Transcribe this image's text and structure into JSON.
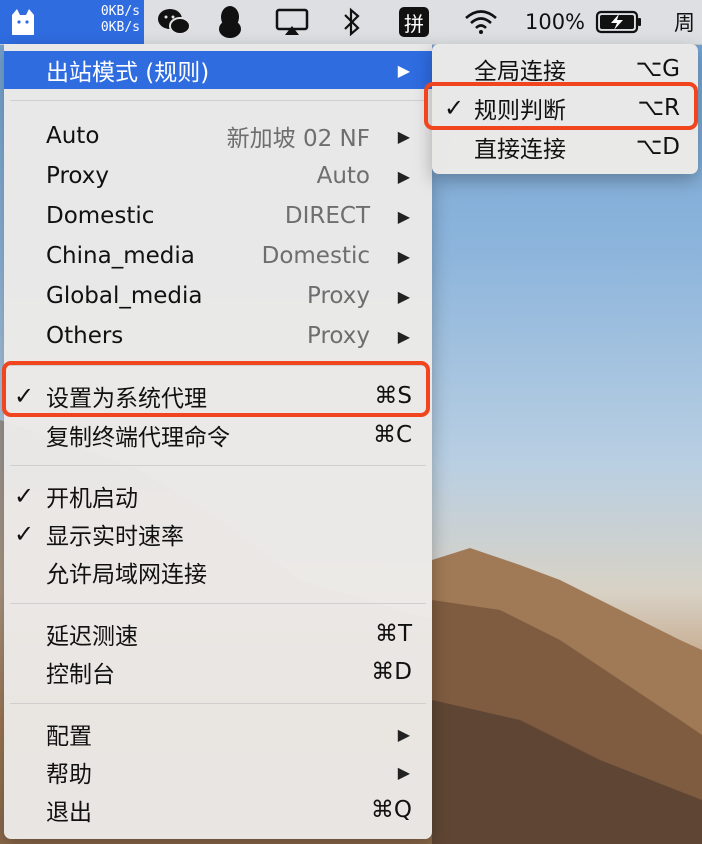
{
  "menubar": {
    "upload_speed": "0KB/s",
    "download_speed": "0KB/s",
    "battery_percent": "100%",
    "clock_partial": "周",
    "icons": [
      "cat-app-icon",
      "wechat-icon",
      "qq-penguin-icon",
      "airplay-icon",
      "bluetooth-icon",
      "pinyin-input-icon",
      "wifi-icon",
      "battery-charging-icon"
    ],
    "input_method_label": "拼"
  },
  "menu": {
    "mode": {
      "label": "出站模式 (规则)"
    },
    "proxies": [
      {
        "label": "Auto",
        "value": "新加坡 02 NF"
      },
      {
        "label": "Proxy",
        "value": "Auto"
      },
      {
        "label": "Domestic",
        "value": "DIRECT"
      },
      {
        "label": "China_media",
        "value": "Domestic"
      },
      {
        "label": "Global_media",
        "value": "Proxy"
      },
      {
        "label": "Others",
        "value": "Proxy"
      }
    ],
    "system_proxy": {
      "label": "设置为系统代理",
      "shortcut": "⌘S",
      "checked": true
    },
    "copy_terminal": {
      "label": "复制终端代理命令",
      "shortcut": "⌘C"
    },
    "launch_at_login": {
      "label": "开机启动",
      "checked": true
    },
    "show_speed": {
      "label": "显示实时速率",
      "checked": true
    },
    "allow_lan": {
      "label": "允许局域网连接"
    },
    "latency_test": {
      "label": "延迟测速",
      "shortcut": "⌘T"
    },
    "dashboard": {
      "label": "控制台",
      "shortcut": "⌘D"
    },
    "config": {
      "label": "配置"
    },
    "help": {
      "label": "帮助"
    },
    "quit": {
      "label": "退出",
      "shortcut": "⌘Q"
    },
    "check_glyph": "✓",
    "arrow_glyph": "▶"
  },
  "submenu": {
    "items": [
      {
        "label": "全局连接",
        "shortcut": "⌥G",
        "checked": false
      },
      {
        "label": "规则判断",
        "shortcut": "⌥R",
        "checked": true
      },
      {
        "label": "直接连接",
        "shortcut": "⌥D",
        "checked": false
      }
    ]
  },
  "colors": {
    "highlight": "#2f6ce0",
    "annotation": "#f0451e"
  }
}
